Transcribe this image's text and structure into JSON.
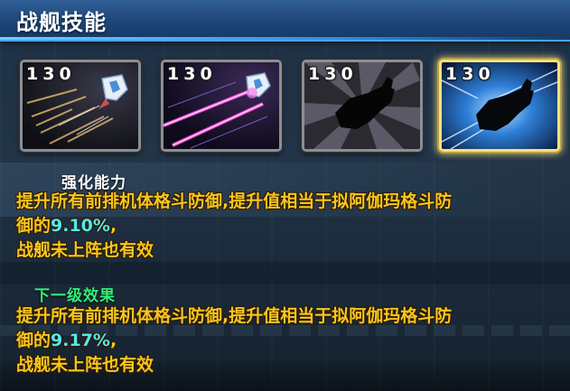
{
  "header": {
    "title": "战舰技能"
  },
  "skills": [
    {
      "level": "130",
      "icon": "ship-speed-trails-icon",
      "selected": false
    },
    {
      "level": "130",
      "icon": "ship-laser-beams-icon",
      "selected": false
    },
    {
      "level": "130",
      "icon": "ship-silhouette-burst-icon",
      "selected": false
    },
    {
      "level": "130",
      "icon": "ship-silhouette-blue-burst-icon",
      "selected": true
    }
  ],
  "current": {
    "title": "强化能力",
    "line1": "提升所有前排机体格斗防御,提升值相当于拟阿伽玛格斗防",
    "line2_prefix": "御的",
    "line2_value": "9.10%",
    "line2_suffix": ",",
    "line3": "战舰未上阵也有效"
  },
  "next": {
    "title": "下一级效果",
    "line1": "提升所有前排机体格斗防御,提升值相当于拟阿伽玛格斗防",
    "line2_prefix": "御的",
    "line2_value": "9.17%",
    "line2_suffix": ",",
    "line3": "战舰未上阵也有效"
  },
  "colors": {
    "header": "#1e4577",
    "description": "#f7c51e",
    "value": "#55e8e8",
    "next_title": "#31ee77",
    "selected_border": "#f4e27a"
  }
}
